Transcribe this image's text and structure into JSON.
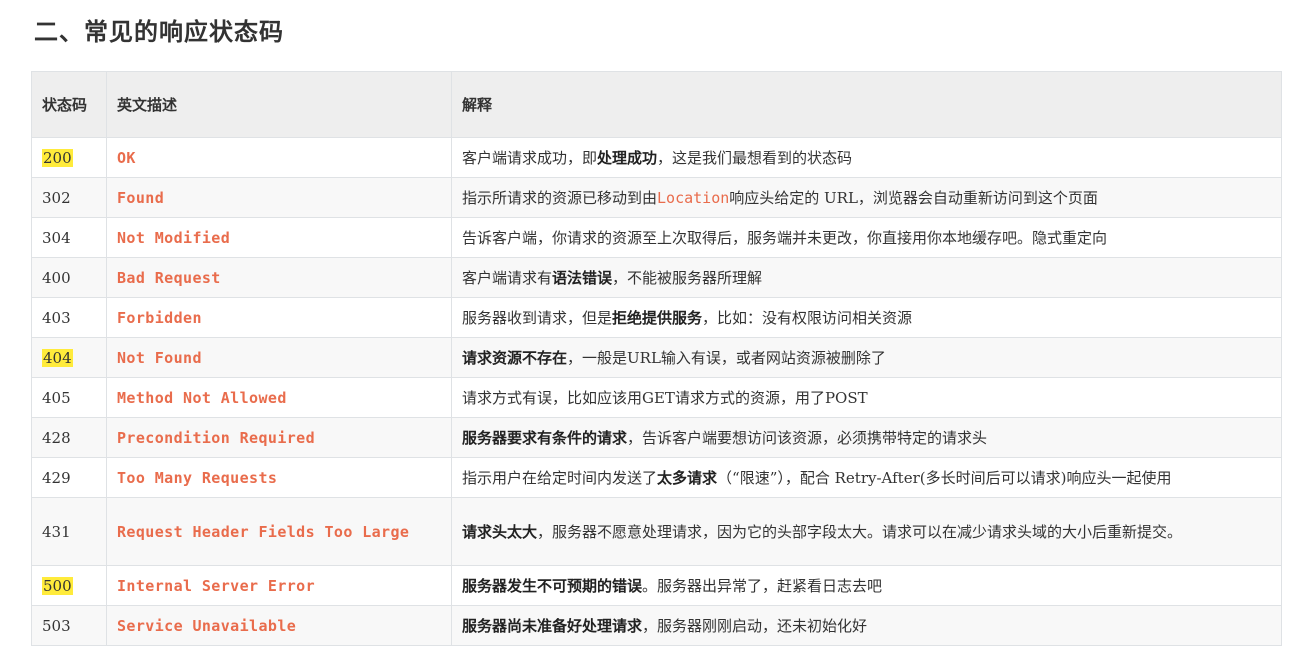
{
  "title": "二、常见的响应状态码",
  "table": {
    "headers": {
      "code": "状态码",
      "desc": "英文描述",
      "expl": "解释"
    },
    "rows": [
      {
        "code": "200",
        "highlight": true,
        "desc": "OK",
        "expl": [
          {
            "t": "客户端请求成功，即"
          },
          {
            "t": "处理成功",
            "b": true
          },
          {
            "t": "，这是我们最想看到的状态码"
          }
        ]
      },
      {
        "code": "302",
        "highlight": false,
        "desc": "Found",
        "expl": [
          {
            "t": "指示所请求的资源已移动到由"
          },
          {
            "t": "Location",
            "m": true
          },
          {
            "t": "响应头给定的 URL，浏览器会自动重新访问到这个页面"
          }
        ]
      },
      {
        "code": "304",
        "highlight": false,
        "desc": "Not Modified",
        "expl": [
          {
            "t": "告诉客户端，你请求的资源至上次取得后，服务端并未更改，你直接用你本地缓存吧。隐式重定向"
          }
        ]
      },
      {
        "code": "400",
        "highlight": false,
        "desc": "Bad Request",
        "expl": [
          {
            "t": "客户端请求有"
          },
          {
            "t": "语法错误",
            "b": true
          },
          {
            "t": "，不能被服务器所理解"
          }
        ]
      },
      {
        "code": "403",
        "highlight": false,
        "desc": "Forbidden",
        "expl": [
          {
            "t": "服务器收到请求，但是"
          },
          {
            "t": "拒绝提供服务",
            "b": true
          },
          {
            "t": "，比如：没有权限访问相关资源"
          }
        ]
      },
      {
        "code": "404",
        "highlight": true,
        "desc": "Not Found",
        "expl": [
          {
            "t": "请求资源不存在",
            "b": true
          },
          {
            "t": "，一般是URL输入有误，或者网站资源被删除了"
          }
        ]
      },
      {
        "code": "405",
        "highlight": false,
        "desc": "Method Not Allowed",
        "expl": [
          {
            "t": "请求方式有误，比如应该用GET请求方式的资源，用了POST"
          }
        ]
      },
      {
        "code": "428",
        "highlight": false,
        "desc": "Precondition Required",
        "expl": [
          {
            "t": "服务器要求有条件的请求",
            "b": true
          },
          {
            "t": "，告诉客户端要想访问该资源，必须携带特定的请求头"
          }
        ]
      },
      {
        "code": "429",
        "highlight": false,
        "desc": "Too Many Requests",
        "expl": [
          {
            "t": "指示用户在给定时间内发送了"
          },
          {
            "t": "太多请求",
            "b": true
          },
          {
            "t": "（“限速”），配合 Retry-After(多长时间后可以请求)响应头一起使用"
          }
        ]
      },
      {
        "code": "431",
        "highlight": false,
        "tall": true,
        "desc": "Request Header Fields Too Large",
        "expl": [
          {
            "t": "请求头太大",
            "b": true
          },
          {
            "t": "，服务器不愿意处理请求，因为它的头部字段太大。请求可以在减少请求头域的大小后重新提交。"
          }
        ]
      },
      {
        "code": "500",
        "highlight": true,
        "desc": "Internal Server Error",
        "expl": [
          {
            "t": "服务器发生不可预期的错误",
            "b": true
          },
          {
            "t": "。服务器出异常了，赶紧看日志去吧"
          }
        ]
      },
      {
        "code": "503",
        "highlight": false,
        "desc": "Service Unavailable",
        "expl": [
          {
            "t": "服务器尚未准备好处理请求",
            "b": true
          },
          {
            "t": "，服务器刚刚启动，还未初始化好"
          }
        ]
      }
    ]
  }
}
